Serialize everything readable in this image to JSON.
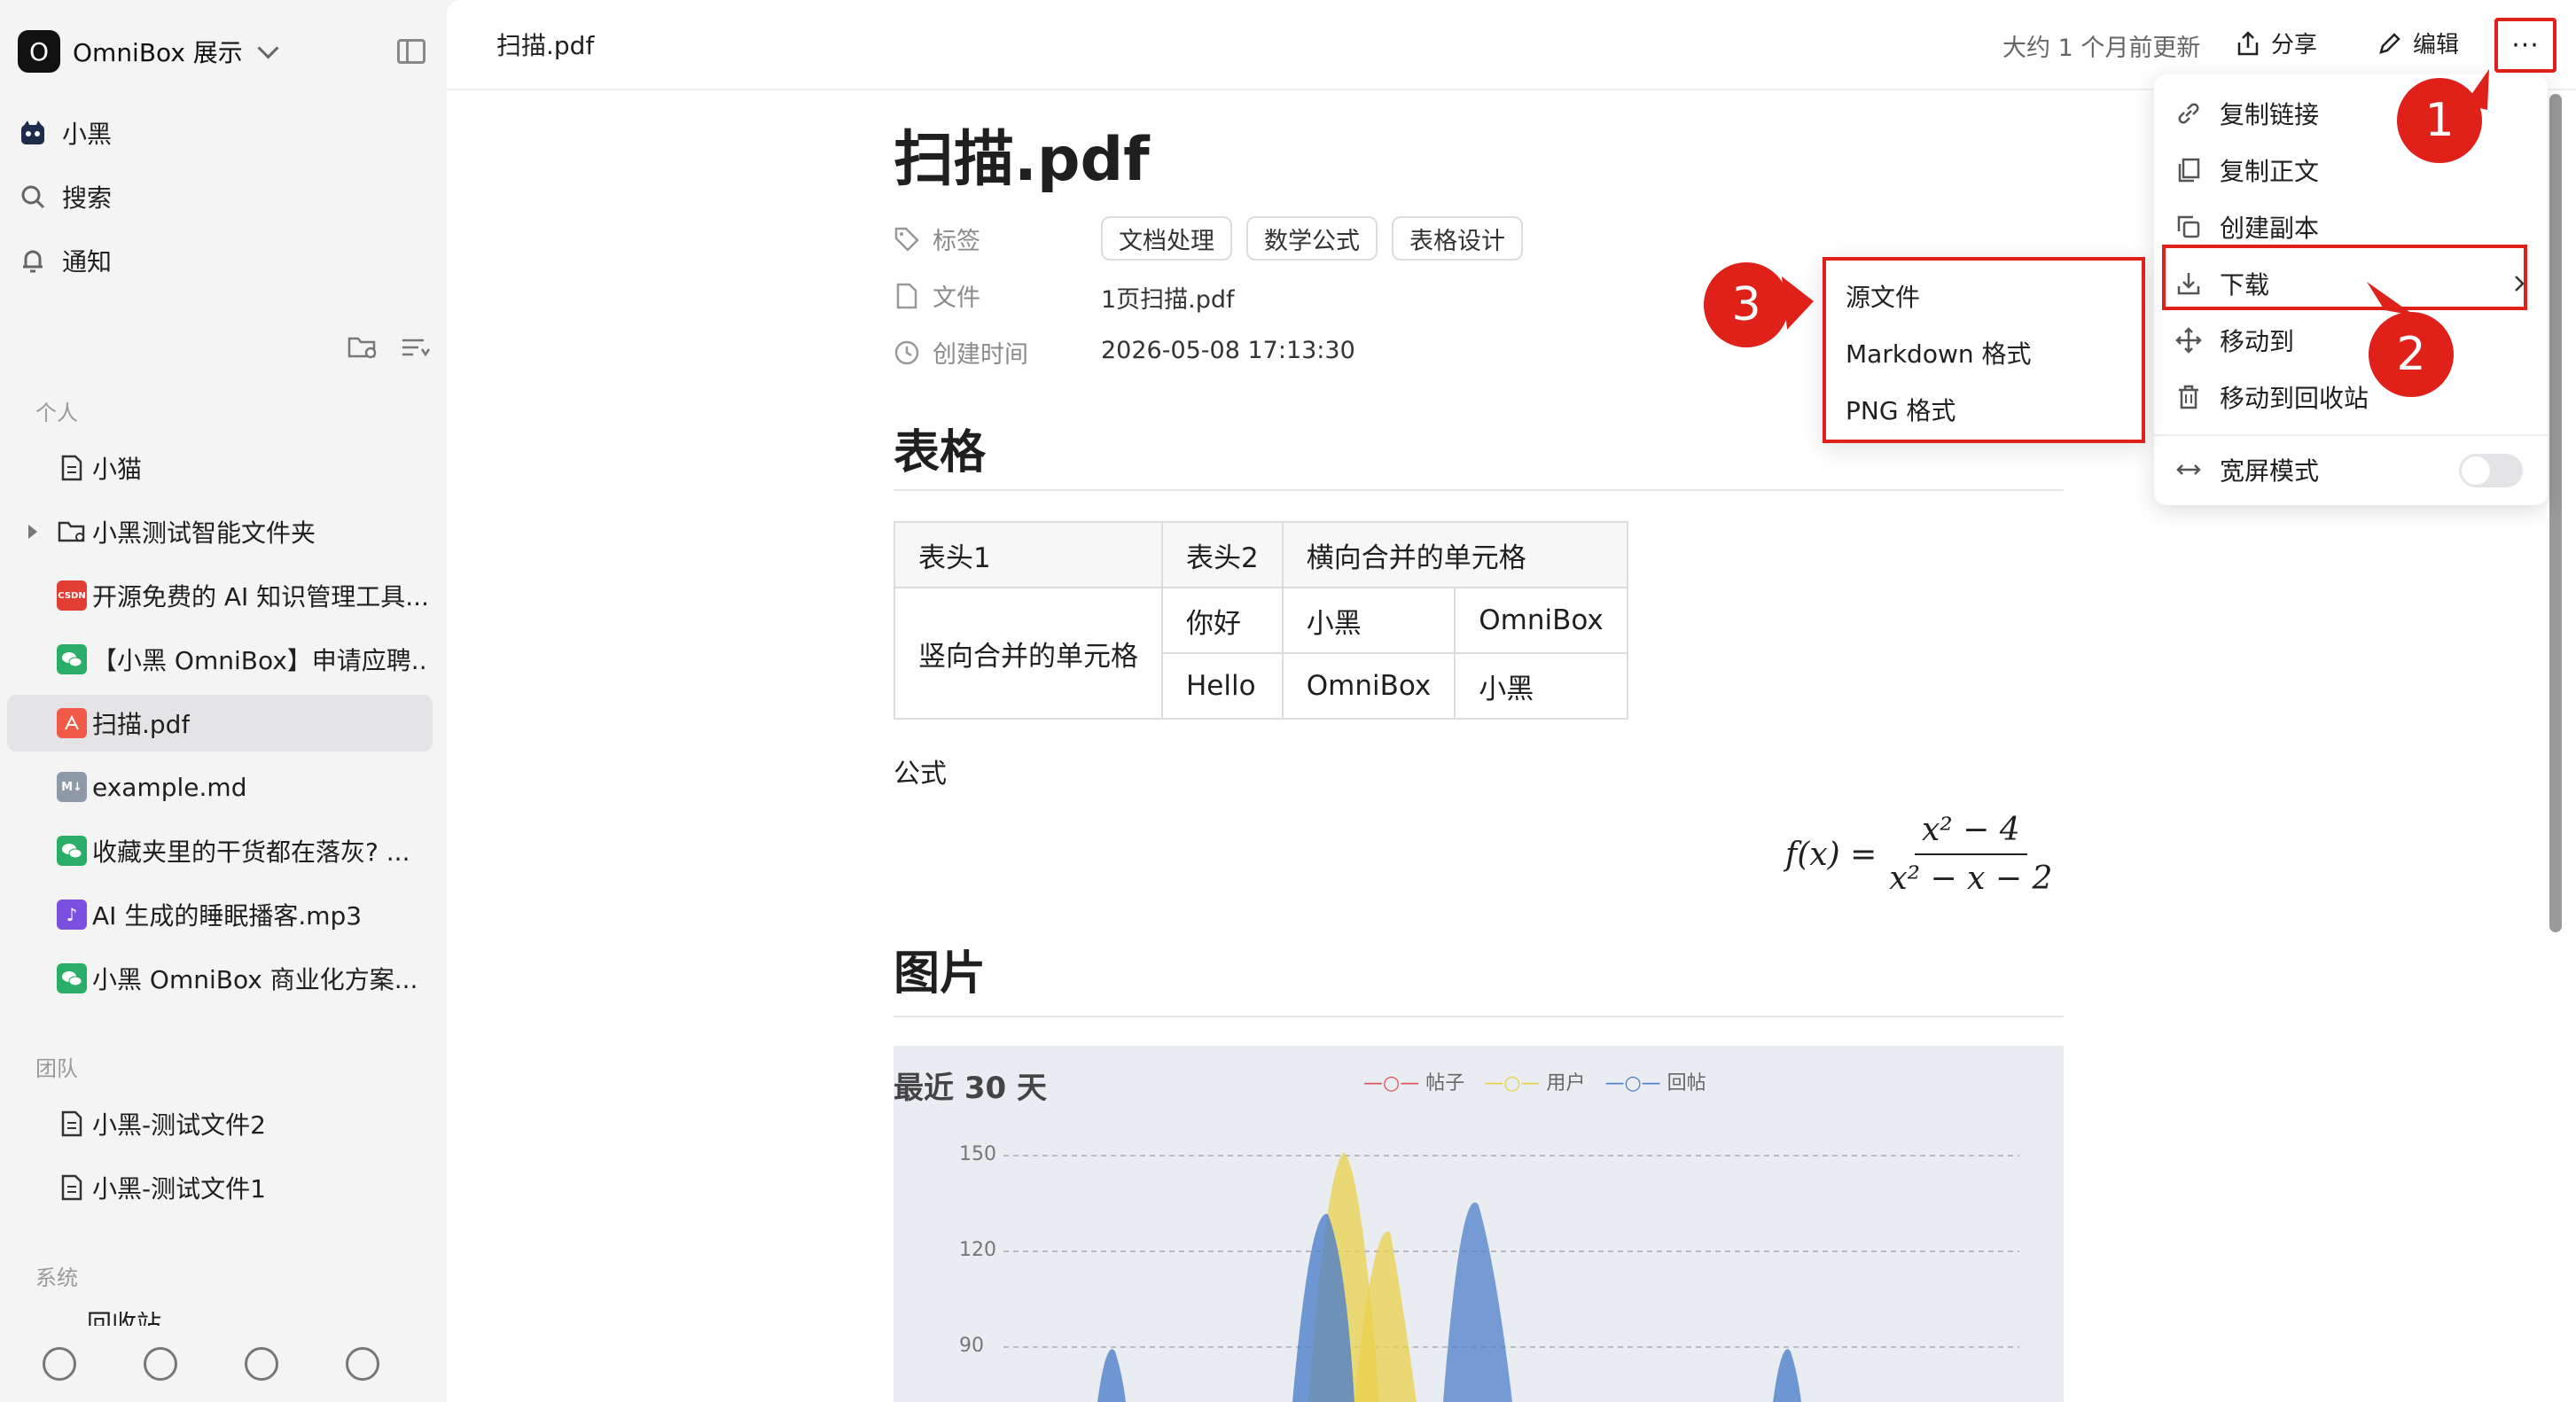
{
  "workspace": {
    "logo": "O",
    "name": "OmniBox 展示"
  },
  "nav": [
    {
      "label": "小黑",
      "icon": "cat-avatar-icon"
    },
    {
      "label": "搜索",
      "icon": "search-icon"
    },
    {
      "label": "通知",
      "icon": "bell-icon"
    }
  ],
  "sections": {
    "personal": "个人",
    "team": "团队",
    "system": "系统"
  },
  "personal_items": [
    {
      "label": "小猫",
      "icon": "document-icon"
    },
    {
      "label": "小黑测试智能文件夹",
      "icon": "smart-folder-icon"
    },
    {
      "label": "开源免费的 AI 知识管理工具...",
      "icon": "csdn-icon"
    },
    {
      "label": "【小黑 OmniBox】申请应聘...",
      "icon": "wechat-icon"
    },
    {
      "label": "扫描.pdf",
      "icon": "pdf-icon"
    },
    {
      "label": "example.md",
      "icon": "markdown-icon"
    },
    {
      "label": "收藏夹里的干货都在落灰? ...",
      "icon": "wechat-icon"
    },
    {
      "label": "AI 生成的睡眠播客.mp3",
      "icon": "audio-icon"
    },
    {
      "label": "小黑 OmniBox 商业化方案...",
      "icon": "wechat-icon"
    }
  ],
  "team_items": [
    {
      "label": "小黑-测试文件2",
      "icon": "document-icon"
    },
    {
      "label": "小黑-测试文件1",
      "icon": "document-icon"
    }
  ],
  "system_partial": "回收站",
  "topbar": {
    "breadcrumb": "扫描.pdf",
    "updated": "大约 1 个月前更新",
    "share": "分享",
    "edit": "编辑",
    "more": "···"
  },
  "doc": {
    "title": "扫描.pdf",
    "meta": {
      "tags_label": "标签",
      "tags": [
        "文档处理",
        "数学公式",
        "表格设计"
      ],
      "file_label": "文件",
      "file": "1页扫描.pdf",
      "created_label": "创建时间",
      "created": "2026-05-08 17:13:30"
    },
    "h_table": "表格",
    "table": {
      "h1": "表头1",
      "h2": "表头2",
      "h3": "横向合并的单元格",
      "merged": "竖向合并的单元格",
      "r1": [
        "你好",
        "小黑",
        "OmniBox"
      ],
      "r2": [
        "Hello",
        "OmniBox",
        "小黑"
      ]
    },
    "formula_label": "公式",
    "formula": {
      "lhs": "f(x) =",
      "num": "x² − 4",
      "den": "x² − x − 2"
    },
    "h_image": "图片",
    "image_chart": {
      "title": "最近 30 天",
      "legend": [
        "帖子",
        "用户",
        "回帖"
      ],
      "y_ticks": [
        "150",
        "120",
        "90"
      ],
      "colors": {
        "posts": "#e0505a",
        "users": "#e8d04a",
        "replies": "#4f7fc9"
      }
    }
  },
  "menu": {
    "items": [
      "复制链接",
      "复制正文",
      "创建副本",
      "下载",
      "移动到",
      "移动到回收站",
      "宽屏模式"
    ],
    "wide_mode_on": false
  },
  "submenu": {
    "items": [
      "源文件",
      "Markdown 格式",
      "PNG 格式"
    ]
  },
  "badges": [
    "1",
    "2",
    "3"
  ],
  "accent": "#e0211a"
}
